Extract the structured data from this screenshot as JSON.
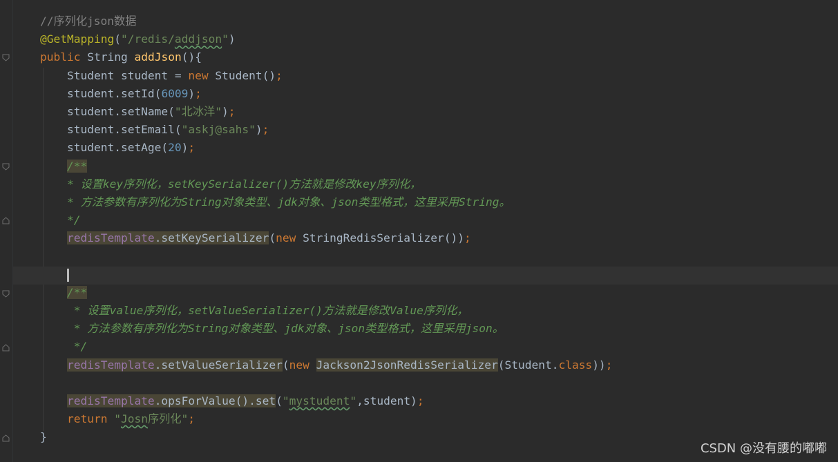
{
  "editor": {
    "lines": [
      {
        "indent": 0,
        "tokens": [
          {
            "t": "//序列化json数据",
            "c": "cm"
          }
        ]
      },
      {
        "indent": 0,
        "tokens": [
          {
            "t": "@GetMapping",
            "c": "ann"
          },
          {
            "t": "(",
            "c": ""
          },
          {
            "t": "\"/redis/",
            "c": "str"
          },
          {
            "t": "addjson",
            "c": "str typo"
          },
          {
            "t": "\"",
            "c": "str"
          },
          {
            "t": ")",
            "c": ""
          }
        ]
      },
      {
        "indent": 0,
        "tokens": [
          {
            "t": "public ",
            "c": "kw"
          },
          {
            "t": "String ",
            "c": ""
          },
          {
            "t": "addJson",
            "c": "fn"
          },
          {
            "t": "(){",
            "c": ""
          }
        ]
      },
      {
        "indent": 4,
        "tokens": [
          {
            "t": "Student student = ",
            "c": ""
          },
          {
            "t": "new ",
            "c": "kw"
          },
          {
            "t": "Student()",
            "c": ""
          },
          {
            "t": ";",
            "c": "kw"
          }
        ]
      },
      {
        "indent": 4,
        "tokens": [
          {
            "t": "student.setId(",
            "c": ""
          },
          {
            "t": "6009",
            "c": "num"
          },
          {
            "t": ")",
            "c": ""
          },
          {
            "t": ";",
            "c": "kw"
          }
        ]
      },
      {
        "indent": 4,
        "tokens": [
          {
            "t": "student.setName(",
            "c": ""
          },
          {
            "t": "\"北冰洋\"",
            "c": "str"
          },
          {
            "t": ")",
            "c": ""
          },
          {
            "t": ";",
            "c": "kw"
          }
        ]
      },
      {
        "indent": 4,
        "tokens": [
          {
            "t": "student.setEmail(",
            "c": ""
          },
          {
            "t": "\"askj@sahs\"",
            "c": "str"
          },
          {
            "t": ")",
            "c": ""
          },
          {
            "t": ";",
            "c": "kw"
          }
        ]
      },
      {
        "indent": 4,
        "tokens": [
          {
            "t": "student.setAge(",
            "c": ""
          },
          {
            "t": "20",
            "c": "num"
          },
          {
            "t": ")",
            "c": ""
          },
          {
            "t": ";",
            "c": "kw"
          }
        ]
      },
      {
        "indent": 4,
        "tokens": [
          {
            "t": "/**",
            "c": "doc hl"
          }
        ]
      },
      {
        "indent": 4,
        "tokens": [
          {
            "t": "* 设置key序列化，setKeySerializer()方法就是修改key序列化，",
            "c": "doc"
          }
        ]
      },
      {
        "indent": 4,
        "tokens": [
          {
            "t": "* 方法参数有序列化为String对象类型、jdk对象、json类型格式，这里采用String。",
            "c": "doc"
          }
        ]
      },
      {
        "indent": 4,
        "tokens": [
          {
            "t": "*/",
            "c": "doc"
          }
        ]
      },
      {
        "indent": 4,
        "tokens": [
          {
            "t": "redisTemplate",
            "c": "field hl"
          },
          {
            "t": ".setKeySerializer",
            "c": "hl"
          },
          {
            "t": "(",
            "c": ""
          },
          {
            "t": "new ",
            "c": "kw"
          },
          {
            "t": "StringRedisSerializer())",
            "c": ""
          },
          {
            "t": ";",
            "c": "kw"
          }
        ]
      },
      {
        "indent": 4,
        "tokens": []
      },
      {
        "indent": 4,
        "tokens": [],
        "cursor": true
      },
      {
        "indent": 4,
        "tokens": [
          {
            "t": "/**",
            "c": "doc hl"
          }
        ]
      },
      {
        "indent": 5,
        "tokens": [
          {
            "t": "* 设置value序列化，setValueSerializer()方法就是修改Value序列化，",
            "c": "doc"
          }
        ]
      },
      {
        "indent": 5,
        "tokens": [
          {
            "t": "* 方法参数有序列化为String对象类型、jdk对象、json类型格式，这里采用json。",
            "c": "doc"
          }
        ]
      },
      {
        "indent": 5,
        "tokens": [
          {
            "t": "*/",
            "c": "doc"
          }
        ]
      },
      {
        "indent": 4,
        "tokens": [
          {
            "t": "redisTemplate",
            "c": "field hl"
          },
          {
            "t": ".setValueSerializer",
            "c": "hl"
          },
          {
            "t": "(",
            "c": ""
          },
          {
            "t": "new ",
            "c": "kw"
          },
          {
            "t": "Jackson2JsonRedisSerializer",
            "c": "hl"
          },
          {
            "t": "(Student.",
            "c": ""
          },
          {
            "t": "class",
            "c": "kw"
          },
          {
            "t": "))",
            "c": ""
          },
          {
            "t": ";",
            "c": "kw"
          }
        ]
      },
      {
        "indent": 4,
        "tokens": []
      },
      {
        "indent": 4,
        "tokens": [
          {
            "t": "redisTemplate",
            "c": "field hl"
          },
          {
            "t": ".opsForValue().set",
            "c": "hl"
          },
          {
            "t": "(",
            "c": ""
          },
          {
            "t": "\"",
            "c": "str"
          },
          {
            "t": "mystudent",
            "c": "str typo"
          },
          {
            "t": "\"",
            "c": "str"
          },
          {
            "t": ",student)",
            "c": ""
          },
          {
            "t": ";",
            "c": "kw"
          }
        ]
      },
      {
        "indent": 4,
        "tokens": [
          {
            "t": "return ",
            "c": "kw"
          },
          {
            "t": "\"",
            "c": "str"
          },
          {
            "t": "Josn",
            "c": "str typo"
          },
          {
            "t": "序列化\"",
            "c": "str"
          },
          {
            "t": ";",
            "c": "kw"
          }
        ]
      },
      {
        "indent": 0,
        "tokens": [
          {
            "t": "}",
            "c": ""
          }
        ]
      }
    ]
  },
  "watermark": "CSDN @没有腰的嘟嘟"
}
